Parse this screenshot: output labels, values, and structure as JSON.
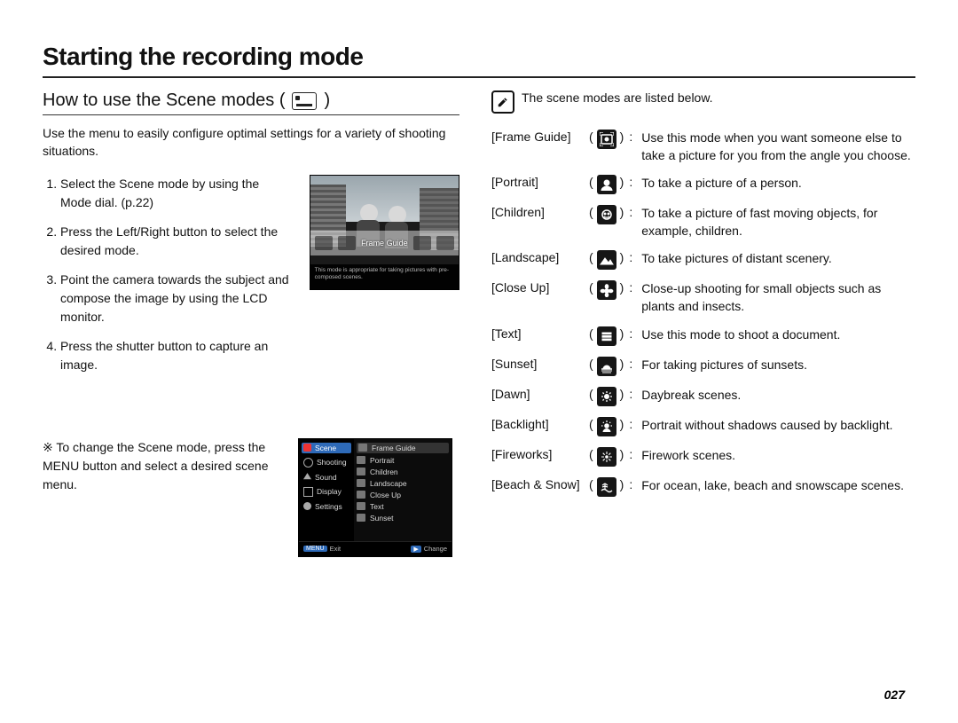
{
  "title": "Starting the recording mode",
  "subhead": "How to use the Scene modes (",
  "subhead_close": ")",
  "intro": "Use the menu to easily configure optimal settings for a variety of shooting situations.",
  "steps": [
    "Select the Scene mode by using the Mode dial. (p.22)",
    "Press the Left/Right button to select the desired mode.",
    "Point the camera towards the subject and compose the image by using the LCD monitor.",
    "Press the shutter button to capture an image."
  ],
  "lcd1": {
    "strip_label": "Frame Guide",
    "caption": "This mode is appropriate for taking pictures with pre-composed scenes."
  },
  "note_sym": "※",
  "note": "To change the Scene mode, press the MENU button and select a desired scene menu.",
  "lcd2": {
    "left_menu": [
      "Scene",
      "Shooting",
      "Sound",
      "Display",
      "Settings"
    ],
    "right_menu": [
      "Frame Guide",
      "Portrait",
      "Children",
      "Landscape",
      "Close Up",
      "Text",
      "Sunset"
    ],
    "footer_left_chip": "MENU",
    "footer_left": "Exit",
    "footer_right_chip": "▶",
    "footer_right": "Change"
  },
  "right_note": "The scene modes are listed below.",
  "modes": [
    {
      "label": "[Frame Guide]",
      "desc": "Use this mode when you want someone else to take a picture for you from the angle you choose.",
      "icon": "frameguide"
    },
    {
      "label": "[Portrait]",
      "desc": "To take a picture of a person.",
      "icon": "portrait"
    },
    {
      "label": "[Children]",
      "desc": "To take a picture of fast moving objects, for example, children.",
      "icon": "children"
    },
    {
      "label": "[Landscape]",
      "desc": "To take pictures of distant scenery.",
      "icon": "landscape"
    },
    {
      "label": "[Close Up]",
      "desc": "Close-up shooting for small objects such as plants and insects.",
      "icon": "closeup"
    },
    {
      "label": "[Text]",
      "desc": "Use this mode to shoot a document.",
      "icon": "text"
    },
    {
      "label": "[Sunset]",
      "desc": "For taking pictures of sunsets.",
      "icon": "sunset"
    },
    {
      "label": "[Dawn]",
      "desc": "Daybreak scenes.",
      "icon": "dawn"
    },
    {
      "label": "[Backlight]",
      "desc": "Portrait without shadows caused by backlight.",
      "icon": "backlight"
    },
    {
      "label": "[Fireworks]",
      "desc": "Firework scenes.",
      "icon": "fireworks"
    },
    {
      "label": "[Beach & Snow]",
      "desc": "For ocean, lake, beach and snowscape scenes.",
      "icon": "beachsnow"
    }
  ],
  "page_num": "027"
}
